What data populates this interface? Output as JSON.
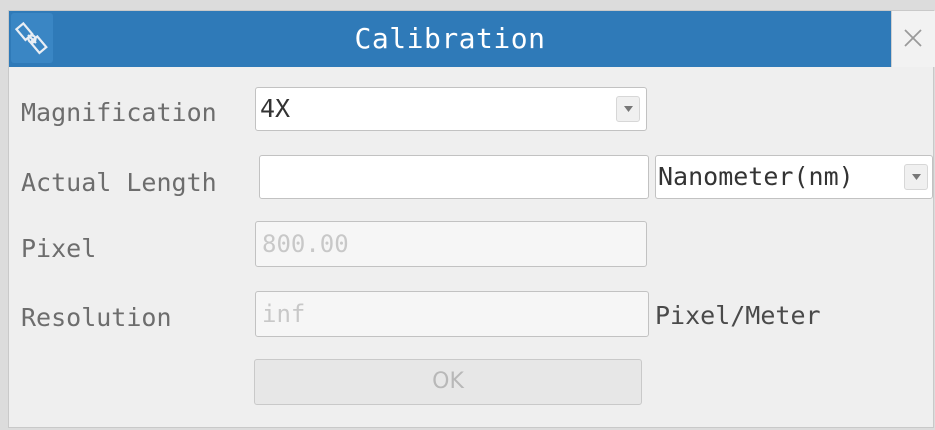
{
  "window": {
    "title": "Calibration",
    "app_icon": "satellite-icon",
    "close_icon": "close-icon",
    "titlebar_color": "#2f7ab8"
  },
  "form": {
    "magnification": {
      "label": "Magnification",
      "value": "4X"
    },
    "actual_length": {
      "label": "Actual Length",
      "value": "",
      "unit": "Nanometer(nm)"
    },
    "pixel": {
      "label": "Pixel",
      "value": "800.00"
    },
    "resolution": {
      "label": "Resolution",
      "value": "inf",
      "unit": "Pixel/Meter"
    },
    "ok_label": "OK"
  }
}
